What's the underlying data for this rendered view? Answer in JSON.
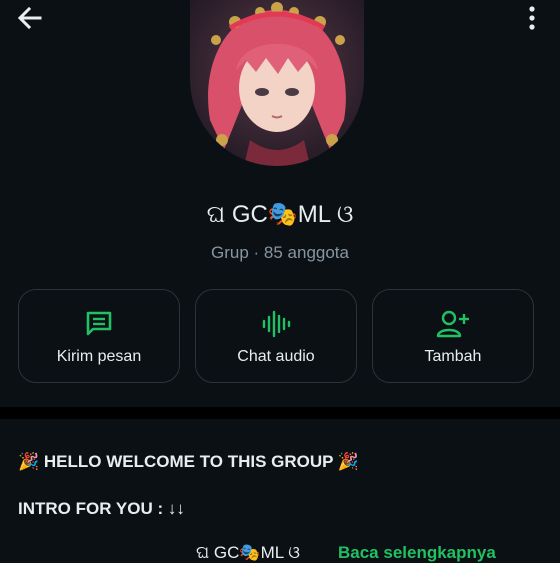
{
  "colors": {
    "accent": "#21c063",
    "background": "#0b1014",
    "muted_text": "#8696a0"
  },
  "header": {
    "back_icon": "arrow-left-icon",
    "menu_icon": "more-vert-icon"
  },
  "group": {
    "name": "ଘ GC🎭ML ଓ",
    "subtitle": "Grup · 85 anggota",
    "avatar": "anime-girl-pink-hair-avatar"
  },
  "actions": [
    {
      "label": "Kirim pesan",
      "icon": "message-icon"
    },
    {
      "label": "Chat audio",
      "icon": "audio-wave-icon"
    },
    {
      "label": "Tambah",
      "icon": "add-person-icon"
    }
  ],
  "description": {
    "line1": "🎉 HELLO WELCOME TO THIS GROUP 🎉",
    "line2": "INTRO FOR YOU : ↓↓",
    "line3_partial": "ଘ GC🎭ML ଓ",
    "read_more": "Baca selengkapnya"
  }
}
